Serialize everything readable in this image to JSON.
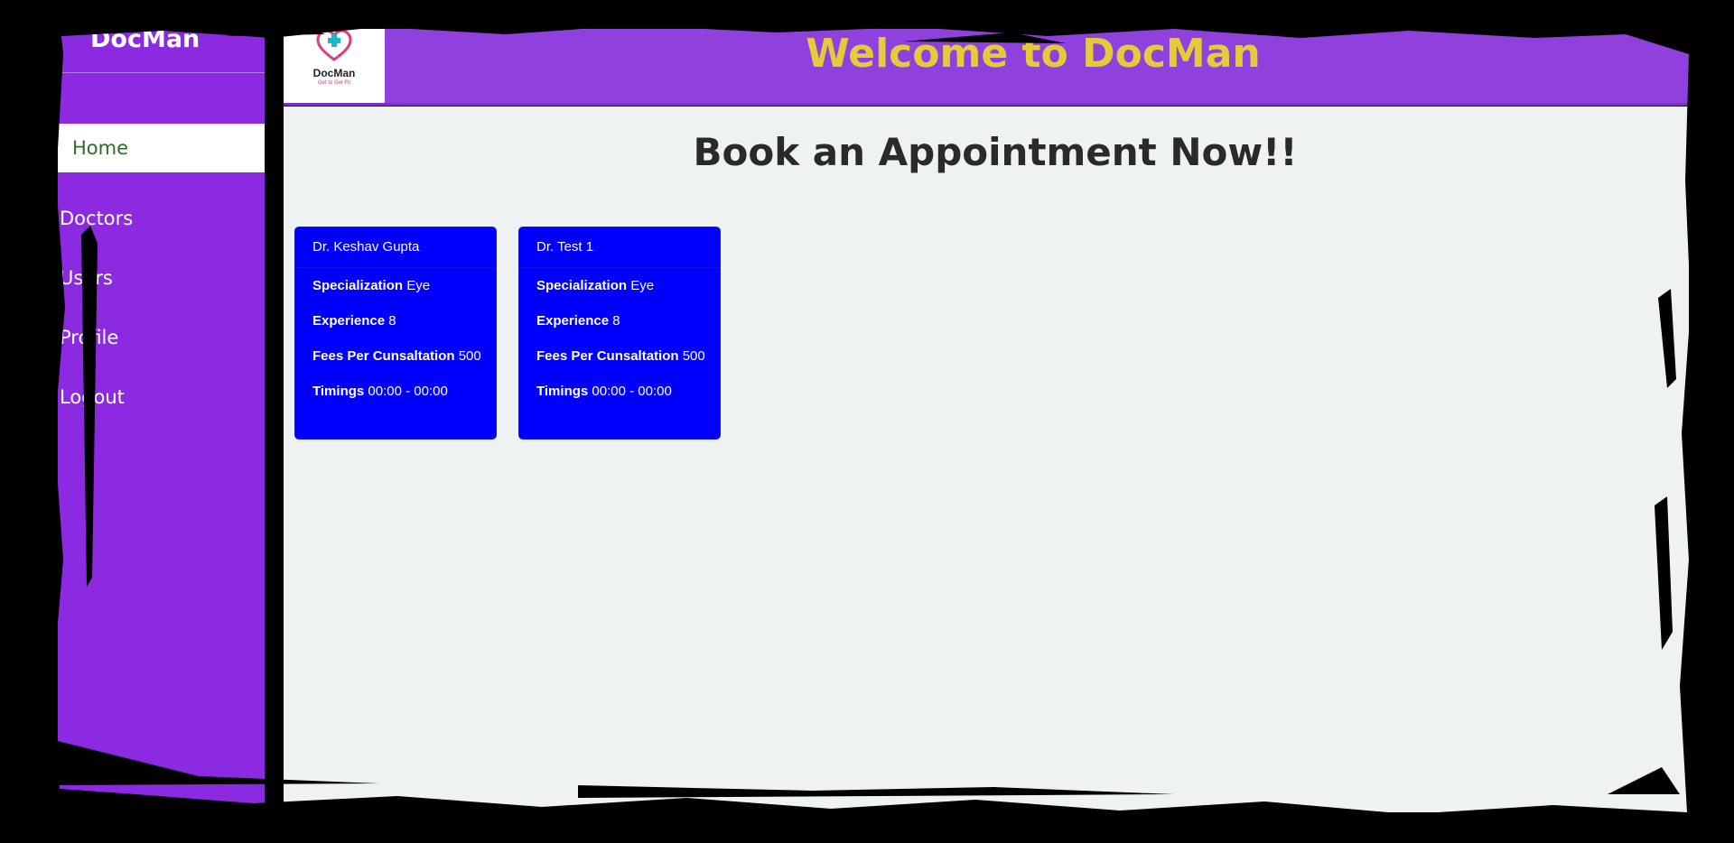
{
  "sidebar": {
    "brand": "DocMan",
    "items": [
      {
        "label": "Home",
        "active": true
      },
      {
        "label": "Doctors",
        "active": false
      },
      {
        "label": "Users",
        "active": false
      },
      {
        "label": "Profile",
        "active": false
      },
      {
        "label": "Logout",
        "active": false
      }
    ]
  },
  "header": {
    "logo_name": "DocMan",
    "logo_tagline": "Get to Get Fit",
    "title": "Welcome to DocMan"
  },
  "main": {
    "title": "Book an Appointment Now!!",
    "labels": {
      "specialization": "Specialization",
      "experience": "Experience",
      "fees": "Fees Per Cunsaltation",
      "timings": "Timings"
    },
    "doctors": [
      {
        "name": "Dr. Keshav Gupta",
        "specialization": "Eye",
        "experience": "8",
        "fees": "500",
        "timings": "00:00 - 00:00"
      },
      {
        "name": "Dr. Test 1",
        "specialization": "Eye",
        "experience": "8",
        "fees": "500",
        "timings": "00:00 - 00:00"
      }
    ]
  },
  "colors": {
    "sidebar": "#8c2ae2",
    "header": "#9040dd",
    "header_title": "#e2cc3a",
    "card": "#0000fe",
    "content_bg": "#eff2f3",
    "active_nav_text": "#2c6e2c"
  },
  "icons": {
    "logo": "heart-cross-icon"
  }
}
